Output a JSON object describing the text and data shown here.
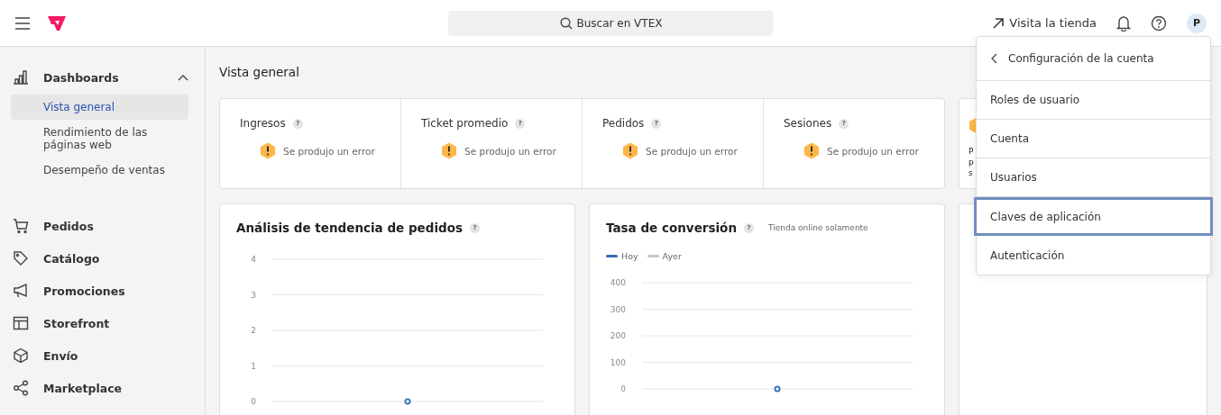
{
  "header": {
    "search": {
      "placeholder": "Buscar en VTEX"
    },
    "store_link": "Visita la tienda",
    "avatar": "P"
  },
  "sidebar": {
    "groups": [
      {
        "label": "Dashboards",
        "expanded": true,
        "children": [
          {
            "label": "Vista general",
            "selected": true
          },
          {
            "label": "Rendimiento de las páginas web",
            "selected": false
          },
          {
            "label": "Desempeño de ventas",
            "selected": false
          }
        ]
      },
      {
        "label": "Pedidos"
      },
      {
        "label": "Catálogo"
      },
      {
        "label": "Promociones"
      },
      {
        "label": "Storefront"
      },
      {
        "label": "Envío"
      },
      {
        "label": "Marketplace"
      }
    ]
  },
  "page": {
    "title": "Vista general",
    "stats": [
      {
        "label": "Ingresos",
        "help": "?",
        "error": "Se produjo un error"
      },
      {
        "label": "Ticket promedio",
        "help": "?",
        "error": "Se produjo un error"
      },
      {
        "label": "Pedidos",
        "help": "?",
        "error": "Se produjo un error"
      },
      {
        "label": "Sesiones",
        "help": "?",
        "error": "Se produjo un error"
      }
    ],
    "side_card": {
      "lines": [
        "P",
        "p",
        "s"
      ]
    },
    "charts": [
      {
        "title": "Análisis de tendencia de pedidos",
        "help": "?",
        "chart_data": {
          "type": "line",
          "grid": true,
          "yticks": [
            0,
            1,
            2,
            3,
            4
          ],
          "ylim": [
            0,
            4
          ],
          "series": [
            {
              "color": "#2f6fb5",
              "marker": true,
              "values": [
                0
              ]
            }
          ]
        }
      },
      {
        "title": "Tasa de conversión",
        "help": "?",
        "subtitle": "Tienda online solamente",
        "chart_data": {
          "type": "line",
          "grid": true,
          "yticks": [
            0,
            100,
            200,
            300,
            400
          ],
          "ylim": [
            0,
            400
          ],
          "series": [
            {
              "name": "Hoy",
              "color": "#2f6fb5",
              "marker": true,
              "values": [
                0
              ]
            },
            {
              "name": "Ayer",
              "color": "#c4c4c4",
              "values": [
                null
              ]
            }
          ]
        }
      }
    ]
  },
  "menu": {
    "title": "Configuración de la cuenta",
    "items": [
      {
        "label": "Roles de usuario",
        "selected": false
      },
      {
        "label": "Cuenta",
        "selected": false
      },
      {
        "label": "Usuarios",
        "selected": false
      },
      {
        "label": "Claves de aplicación",
        "selected": true
      },
      {
        "label": "Autenticación",
        "selected": false
      }
    ]
  }
}
